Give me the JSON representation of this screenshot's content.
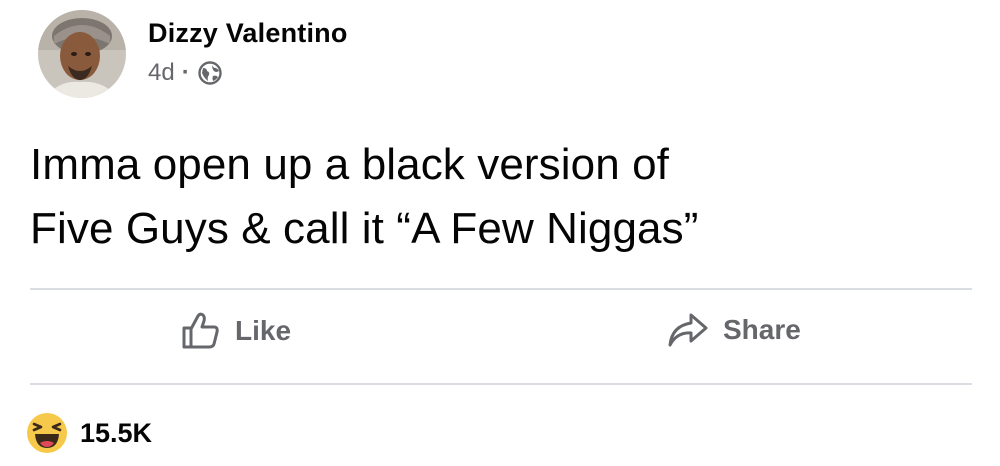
{
  "post": {
    "author": "Dizzy Valentino",
    "timestamp": "4d",
    "separator": "·",
    "audience_icon": "globe-icon",
    "text_lines": [
      "Imma open up a black version of",
      "Five Guys & call it “A Few Niggas”"
    ]
  },
  "actions": {
    "like_label": "Like",
    "like_icon": "thumbs-up-outline-icon",
    "share_label": "Share",
    "share_icon": "share-arrow-icon"
  },
  "reactions": {
    "icon": "haha-emoji-icon",
    "count": "15.5K"
  },
  "colors": {
    "secondary_text": "#65676b",
    "primary_text": "#050505",
    "divider": "#dadde1",
    "haha_yellow": "#f7c94a"
  }
}
